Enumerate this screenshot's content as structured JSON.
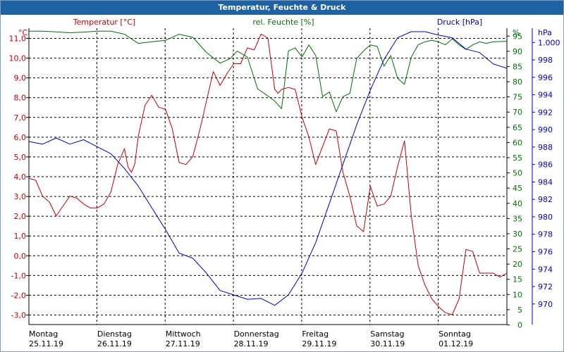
{
  "window": {
    "title": "Temperatur, Feuchte & Druck"
  },
  "colors": {
    "temperature": "#c00000",
    "humidity": "#007000",
    "pressure": "#0000c0",
    "grid": "#000000",
    "text": "#000000",
    "title_bg": "#1f62a4"
  },
  "chart_data": {
    "type": "line",
    "title": "Temperatur, Feuchte & Druck",
    "grid": true,
    "legend": "top",
    "x_ticks": [
      {
        "day": "Montag",
        "date": "25.11.19"
      },
      {
        "day": "Dienstag",
        "date": "26.11.19"
      },
      {
        "day": "Mittwoch",
        "date": "27.11.19"
      },
      {
        "day": "Donnerstag",
        "date": "28.11.19"
      },
      {
        "day": "Freitag",
        "date": "29.11.19"
      },
      {
        "day": "Samstag",
        "date": "30.11.19"
      },
      {
        "day": "Sonntag",
        "date": "01.12.19"
      }
    ],
    "xlim": [
      0,
      7
    ],
    "axes": {
      "temperature": {
        "label": "Temperatur [°C]",
        "unit": "°C",
        "ylim": [
          -3.5,
          11.5
        ],
        "ticks": [
          "11,0",
          "10,0",
          "9,0",
          "8,0",
          "7,0",
          "6,0",
          "5,0",
          "4,0",
          "3,0",
          "2,0",
          "1,0",
          "0,0",
          "-1,0",
          "-2,0",
          "-3,0"
        ],
        "tick_values": [
          11,
          10,
          9,
          8,
          7,
          6,
          5,
          4,
          3,
          2,
          1,
          0,
          -1,
          -2,
          -3
        ]
      },
      "humidity": {
        "label": "rel. Feuchte [%]",
        "unit": "%",
        "ylim": [
          0,
          97.5
        ],
        "ticks": [
          "95",
          "90",
          "85",
          "80",
          "75",
          "70",
          "65",
          "60",
          "55",
          "50",
          "45",
          "40",
          "35",
          "30",
          "25",
          "20",
          "15",
          "10",
          "5",
          "0"
        ],
        "tick_values": [
          95,
          90,
          85,
          80,
          75,
          70,
          65,
          60,
          55,
          50,
          45,
          40,
          35,
          30,
          25,
          20,
          15,
          10,
          5,
          0
        ]
      },
      "pressure": {
        "label": "Druck [hPa]",
        "unit": "hPa",
        "ylim": [
          967.6,
          1001.6
        ],
        "ticks": [
          "1.000",
          "998",
          "996",
          "994",
          "992",
          "990",
          "988",
          "986",
          "984",
          "982",
          "980",
          "978",
          "976",
          "974",
          "972",
          "970"
        ],
        "tick_values": [
          1000,
          998,
          996,
          994,
          992,
          990,
          988,
          986,
          984,
          982,
          980,
          978,
          976,
          974,
          972,
          970
        ]
      }
    },
    "series": [
      {
        "name": "Temperatur [°C]",
        "axis": "temperature",
        "x": [
          0,
          0.1,
          0.2,
          0.3,
          0.4,
          0.5,
          0.6,
          0.7,
          0.8,
          0.9,
          1.0,
          1.1,
          1.2,
          1.3,
          1.4,
          1.45,
          1.5,
          1.55,
          1.6,
          1.7,
          1.8,
          1.9,
          2.0,
          2.1,
          2.2,
          2.3,
          2.4,
          2.5,
          2.6,
          2.7,
          2.8,
          2.9,
          3.0,
          3.1,
          3.2,
          3.3,
          3.4,
          3.5,
          3.6,
          3.65,
          3.7,
          3.8,
          3.9,
          4.0,
          4.1,
          4.2,
          4.3,
          4.4,
          4.5,
          4.6,
          4.7,
          4.8,
          4.9,
          5.0,
          5.05,
          5.1,
          5.2,
          5.3,
          5.4,
          5.5,
          5.6,
          5.7,
          5.8,
          5.9,
          6.0,
          6.1,
          6.2,
          6.3,
          6.4,
          6.5,
          6.6,
          6.7,
          6.8,
          6.9,
          7.0
        ],
        "values": [
          3.9,
          3.8,
          3.0,
          2.7,
          2.0,
          2.5,
          3.0,
          2.9,
          2.6,
          2.4,
          2.4,
          2.6,
          3.2,
          4.6,
          5.4,
          4.5,
          4.2,
          4.6,
          6.0,
          7.6,
          8.1,
          7.5,
          7.4,
          6.4,
          4.7,
          4.6,
          5.0,
          6.3,
          7.8,
          9.3,
          8.6,
          9.2,
          9.7,
          9.7,
          10.5,
          10.4,
          11.2,
          11.0,
          8.4,
          8.2,
          8.4,
          8.5,
          8.4,
          7.0,
          6.0,
          4.6,
          5.5,
          6.4,
          6.3,
          4.2,
          3.0,
          1.5,
          1.2,
          3.5,
          3.0,
          2.5,
          2.6,
          3.0,
          4.5,
          5.8,
          2.0,
          -0.5,
          -1.5,
          -2.2,
          -2.6,
          -2.9,
          -3.0,
          -2.2,
          0.3,
          0.2,
          -0.9,
          -0.9,
          -0.9,
          -1.1,
          -0.9
        ]
      },
      {
        "name": "rel. Feuchte [%]",
        "axis": "humidity",
        "x": [
          0,
          0.2,
          0.4,
          0.6,
          0.8,
          1.0,
          1.2,
          1.4,
          1.6,
          1.8,
          2.0,
          2.2,
          2.4,
          2.6,
          2.8,
          2.95,
          3.05,
          3.2,
          3.35,
          3.45,
          3.6,
          3.7,
          3.8,
          3.9,
          4.0,
          4.1,
          4.2,
          4.3,
          4.4,
          4.5,
          4.6,
          4.7,
          4.8,
          4.9,
          5.0,
          5.1,
          5.2,
          5.3,
          5.4,
          5.5,
          5.6,
          5.7,
          5.8,
          5.9,
          6.0,
          6.1,
          6.2,
          6.3,
          6.4,
          6.5,
          6.6,
          6.7,
          6.8,
          7.0
        ],
        "values": [
          96.5,
          96.5,
          96.3,
          96.0,
          96.2,
          96.5,
          96.5,
          95.5,
          92.5,
          93,
          93.5,
          95.5,
          94.5,
          89.5,
          86.0,
          87.5,
          90.0,
          88.0,
          77.5,
          76.0,
          73.5,
          71.0,
          90.0,
          91.0,
          88.0,
          92.0,
          88.5,
          75.0,
          76.5,
          70.0,
          75.0,
          76.0,
          87.5,
          90.0,
          92.0,
          91.5,
          85.0,
          88.5,
          81.0,
          79.0,
          88.0,
          92.0,
          93.0,
          93.5,
          93.0,
          92.0,
          94.0,
          92.0,
          90.5,
          92.0,
          93.0,
          92.5,
          93.0,
          93.2
        ]
      },
      {
        "name": "Druck [hPa]",
        "axis": "pressure",
        "x": [
          0,
          0.2,
          0.4,
          0.6,
          0.8,
          1.0,
          1.2,
          1.4,
          1.6,
          1.8,
          2.0,
          2.2,
          2.4,
          2.6,
          2.8,
          3.0,
          3.2,
          3.4,
          3.6,
          3.8,
          4.0,
          4.2,
          4.4,
          4.6,
          4.8,
          5.0,
          5.2,
          5.4,
          5.6,
          5.8,
          6.0,
          6.2,
          6.4,
          6.6,
          6.8,
          7.0
        ],
        "values": [
          988.6,
          988.3,
          989.0,
          988.3,
          988.8,
          988.0,
          987.2,
          985.5,
          983.5,
          981.0,
          978.5,
          975.8,
          975.2,
          973.5,
          971.5,
          971.0,
          970.5,
          970.6,
          969.8,
          971.0,
          973.5,
          977.0,
          981.5,
          986.0,
          990.5,
          994.5,
          998.0,
          1000.5,
          1001.2,
          1001.2,
          1000.8,
          1000.5,
          999.2,
          998.8,
          997.5,
          997.0
        ]
      }
    ]
  }
}
